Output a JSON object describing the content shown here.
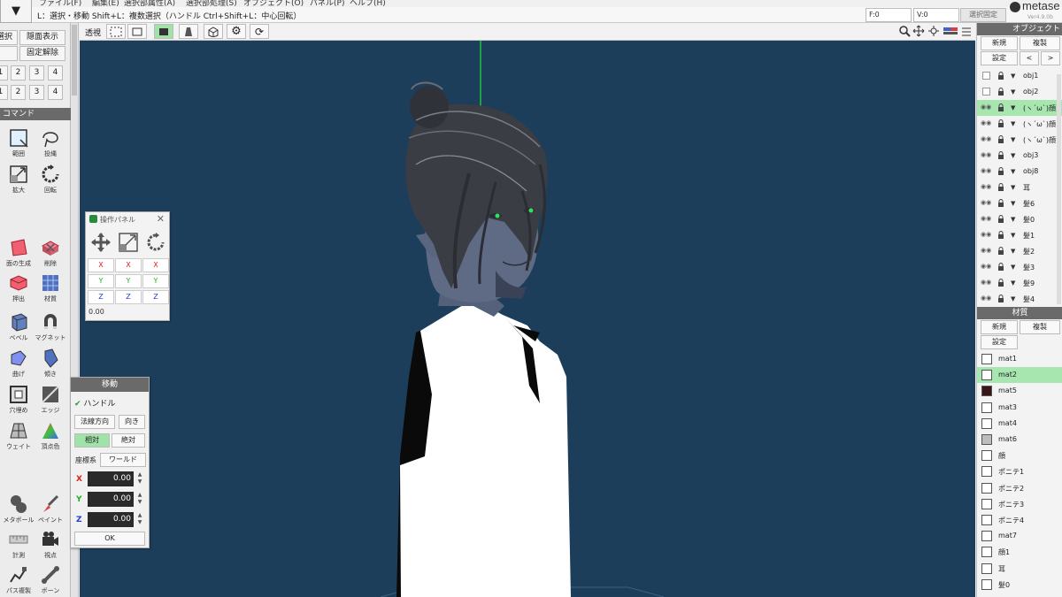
{
  "menubar": {
    "items": [
      "ファイル(F)",
      "編集(E)",
      "選択部属性(A)",
      "選択部処理(S)",
      "オブジェクト(O)",
      "パネル(P)",
      "ヘルプ(H)"
    ]
  },
  "app_menu_icon": "chevron-down-icon",
  "status": {
    "hint": "L：選択・移動  Shift+L：複数選択（ハンドル  Ctrl+Shift+L：中心回転）",
    "face_count": "F:0",
    "vertex_count": "V:0",
    "lock_label": "選択固定"
  },
  "logo": {
    "text": "metase",
    "version": "Ver4.9.0b"
  },
  "left_panel": {
    "buttons": [
      {
        "label": "選択"
      },
      {
        "label": "隠面表示"
      },
      {
        "label": ""
      },
      {
        "label": "固定解除"
      }
    ],
    "row1": [
      "1",
      "2",
      "3",
      "4"
    ],
    "row2": [
      "1",
      "2",
      "3",
      "4"
    ],
    "command_header": "コマンド",
    "commands": [
      {
        "label": "範囲",
        "icon": "select-rect-icon"
      },
      {
        "label": "投縄",
        "icon": "lasso-icon"
      },
      {
        "label": "拡大",
        "icon": "scale-icon"
      },
      {
        "label": "回転",
        "icon": "rotate-icon"
      },
      {
        "label": "面の生成",
        "icon": "create-face-icon"
      },
      {
        "label": "削除",
        "icon": "delete-icon"
      },
      {
        "label": "押出",
        "icon": "extrude-icon"
      },
      {
        "label": "材質",
        "icon": "material-icon"
      },
      {
        "label": "ベベル",
        "icon": "bevel-icon"
      },
      {
        "label": "マグネット",
        "icon": "magnet-icon"
      },
      {
        "label": "曲げ",
        "icon": "bend-icon"
      },
      {
        "label": "傾き",
        "icon": "tilt-icon"
      },
      {
        "label": "穴埋め",
        "icon": "fill-hole-icon"
      },
      {
        "label": "エッジ",
        "icon": "edge-icon"
      },
      {
        "label": "ウェイト",
        "icon": "weight-icon"
      },
      {
        "label": "頂点色",
        "icon": "vertex-color-icon"
      },
      {
        "label": "メタボール",
        "icon": "metaball-icon"
      },
      {
        "label": "ペイント",
        "icon": "paint-icon"
      },
      {
        "label": "計測",
        "icon": "measure-icon"
      },
      {
        "label": "視点",
        "icon": "camera-icon"
      },
      {
        "label": "パス複製",
        "icon": "path-duplicate-icon"
      },
      {
        "label": "ボーン",
        "icon": "bone-icon"
      }
    ]
  },
  "view_toolbar": {
    "label": "透視"
  },
  "op_panel": {
    "title": "操作パネル",
    "x": "X",
    "y": "Y",
    "z": "Z",
    "value": "0.00"
  },
  "move_panel": {
    "title": "移動",
    "handle_label": "ハンドル",
    "normal_dir": "法線方向",
    "orient": "向き",
    "relative": "相対",
    "absolute": "絶対",
    "coord_label": "座標系",
    "coord_value": "ワールド",
    "x_label": "X",
    "x_value": "0.00",
    "y_label": "Y",
    "y_value": "0.00",
    "z_label": "Z",
    "z_value": "0.00",
    "ok": "OK"
  },
  "object_panel": {
    "header": "オブジェクト",
    "new": "新規",
    "duplicate": "複製",
    "settings": "設定",
    "prev": "<",
    "next": ">",
    "items": [
      {
        "name": "obj1",
        "kind": "check"
      },
      {
        "name": "obj2",
        "kind": "check"
      },
      {
        "name": "(ヽ´ω`)顔",
        "kind": "eye",
        "selected": true
      },
      {
        "name": "(ヽ´ω`)顔",
        "kind": "eye"
      },
      {
        "name": "(ヽ´ω`)顔",
        "kind": "eye"
      },
      {
        "name": "obj3",
        "kind": "eye"
      },
      {
        "name": "obj8",
        "kind": "eye"
      },
      {
        "name": "耳",
        "kind": "eye"
      },
      {
        "name": "髪6",
        "kind": "eye"
      },
      {
        "name": "髪0",
        "kind": "eye"
      },
      {
        "name": "髪1",
        "kind": "eye"
      },
      {
        "name": "髪2",
        "kind": "eye"
      },
      {
        "name": "髪3",
        "kind": "eye"
      },
      {
        "name": "髪9",
        "kind": "eye"
      },
      {
        "name": "髪4",
        "kind": "eye"
      }
    ]
  },
  "material_panel": {
    "header": "材質",
    "new": "新規",
    "duplicate": "複製",
    "settings": "設定",
    "items": [
      {
        "name": "mat1",
        "color": "#ffffff"
      },
      {
        "name": "mat2",
        "color": "#ffffff",
        "selected": true
      },
      {
        "name": "mat5",
        "color": "#3a1616"
      },
      {
        "name": "mat3",
        "color": "#ffffff"
      },
      {
        "name": "mat4",
        "color": "#ffffff"
      },
      {
        "name": "mat6",
        "color": "#bdbdbd"
      },
      {
        "name": "顔",
        "color": "#ffffff"
      },
      {
        "name": "ポニテ1",
        "color": "#ffffff"
      },
      {
        "name": "ポニテ2",
        "color": "#ffffff"
      },
      {
        "name": "ポニテ3",
        "color": "#ffffff"
      },
      {
        "name": "ポニテ4",
        "color": "#ffffff"
      },
      {
        "name": "mat7",
        "color": "#ffffff"
      },
      {
        "name": "顔1",
        "color": "#ffffff"
      },
      {
        "name": "耳",
        "color": "#ffffff"
      },
      {
        "name": "髪0",
        "color": "#ffffff"
      }
    ]
  },
  "colors": {
    "viewport_bg": "#1d3e5a",
    "selected_row": "#a8e6b0",
    "axis_x": "#e02020",
    "axis_y": "#20b020",
    "axis_z": "#2040d0"
  }
}
